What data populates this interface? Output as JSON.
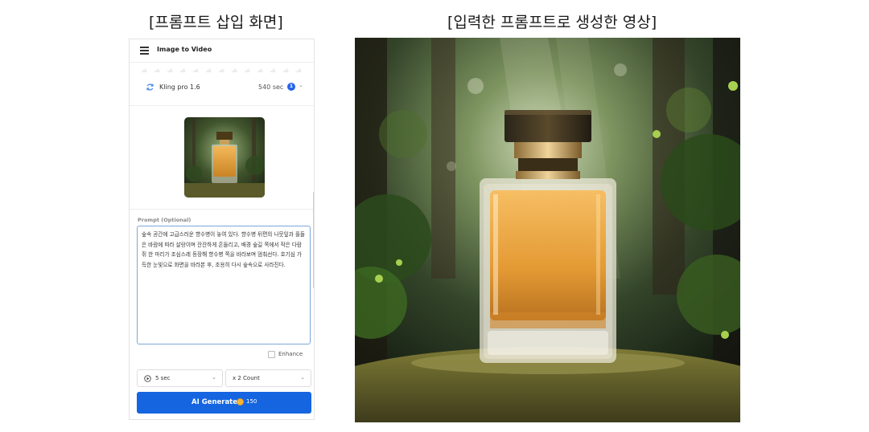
{
  "captions": {
    "left": "[프롬프트 삽입 화면]",
    "right": "[입력한 프롬프트로 생성한 영상]"
  },
  "app": {
    "title": "Image to Video",
    "menu_icon": "hamburger-menu-icon"
  },
  "model": {
    "name": "Kling pro 1.6",
    "credits": "540 sec",
    "badge": "1",
    "icon": "refresh-icon",
    "chevron": "chevron-down-icon"
  },
  "prompt": {
    "label": "Prompt (Optional)",
    "text": "숲속 공간에 고급스러운 향수병이 놓여 있다. 향수병 뒤편의 나뭇잎과 풀들은 바람에 따라 살랑이며 잔잔하게 흔들리고, 배경 숲길 쪽에서 작은 다람쥐 한 마리가 조심스레 등장해 향수병 쪽을 바라보며 멈춰선다. 호기심 가득한 눈빛으로 화면을 바라본 후, 조용히 다시 숲속으로 사라진다."
  },
  "enhance": {
    "label": "Enhance",
    "checked": false
  },
  "duration": {
    "value": "5 sec",
    "icon": "play-circle-icon"
  },
  "count": {
    "value": "x 2 Count"
  },
  "generate": {
    "label": "AI Generate",
    "cost": "150",
    "icon": "coin-icon"
  },
  "colors": {
    "accent": "#1565e0",
    "border_focus": "#7aa7d9",
    "badge": "#2563eb"
  }
}
